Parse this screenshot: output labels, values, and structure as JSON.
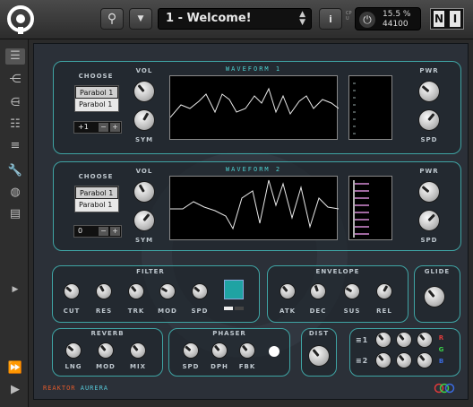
{
  "topbar": {
    "preset": "1 - Welcome!",
    "cpu": "15.5 %",
    "sample_rate": "44100",
    "side_label": "CPU"
  },
  "wave1": {
    "title": "WAVEFORM 1",
    "choose_label": "CHOOSE",
    "items": [
      "Parabol 1",
      "Parabol 1"
    ],
    "spin_value": "+1",
    "vol": "VOL",
    "sym": "SYM",
    "pwr": "PWR",
    "spd": "SPD"
  },
  "wave2": {
    "title": "WAVEFORM 2",
    "choose_label": "CHOOSE",
    "items": [
      "Parabol 1",
      "Parabol 1"
    ],
    "spin_value": "0",
    "vol": "VOL",
    "sym": "SYM",
    "pwr": "PWR",
    "spd": "SPD"
  },
  "filter": {
    "title": "FILTER",
    "knobs": [
      "CUT",
      "RES",
      "TRK",
      "MOD",
      "SPD"
    ]
  },
  "envelope": {
    "title": "ENVELOPE",
    "knobs": [
      "ATK",
      "DEC",
      "SUS",
      "REL"
    ]
  },
  "glide": {
    "title": "GLIDE"
  },
  "reverb": {
    "title": "REVERB",
    "knobs": [
      "LNG",
      "MOD",
      "MIX"
    ]
  },
  "phaser": {
    "title": "PHASER",
    "knobs": [
      "SPD",
      "DPH",
      "FBK"
    ]
  },
  "dist": {
    "title": "DIST"
  },
  "mixer": {
    "row1": "≡1",
    "row2": "≡2",
    "r": "R",
    "g": "G",
    "b": "B"
  },
  "footer": {
    "brand": "REAKTOR",
    "product": "AURERA"
  },
  "buttons": {
    "minus": "−",
    "plus": "+"
  },
  "colors": {
    "accent": "#3fa4a4",
    "cyan_square": "#1fa3a3"
  }
}
